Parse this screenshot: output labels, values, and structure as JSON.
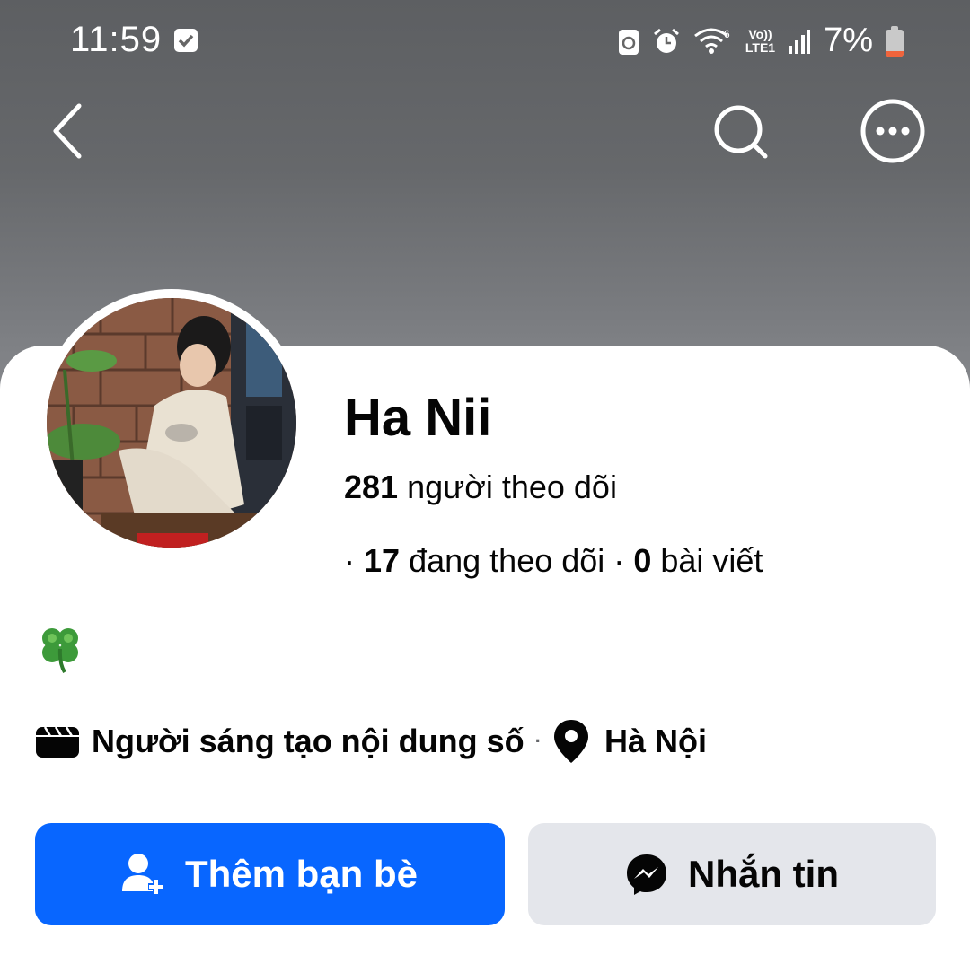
{
  "status_bar": {
    "time": "11:59",
    "battery_percent": "7%",
    "network_label": "LTE1",
    "volte_label": "Vo))"
  },
  "profile": {
    "name": "Ha Nii",
    "followers_count": "281",
    "followers_label": "người theo dõi",
    "following_count": "17",
    "following_label": "đang theo dõi",
    "posts_count": "0",
    "posts_label": "bài viết",
    "bio": "🍀",
    "category": "Người sáng tạo nội dung số",
    "location": "Hà Nội"
  },
  "actions": {
    "add_friend_label": "Thêm bạn bè",
    "message_label": "Nhắn tin"
  },
  "colors": {
    "primary_blue": "#0866ff",
    "secondary_button": "#e4e6eb",
    "text": "#050505"
  }
}
